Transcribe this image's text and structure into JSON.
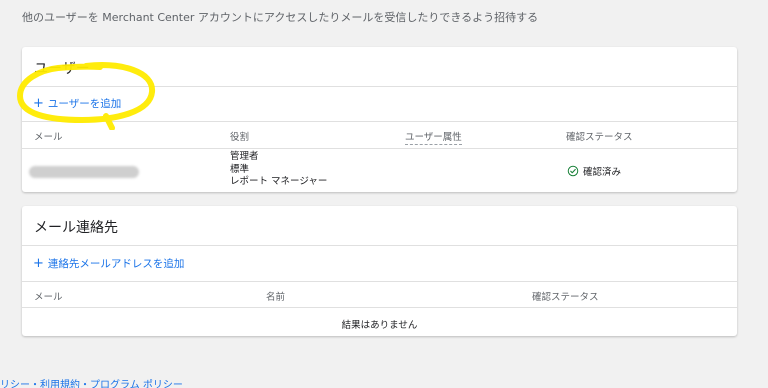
{
  "intro_text": "他のユーザーを Merchant Center アカウントにアクセスしたりメールを受信したりできるよう招待する",
  "users_card": {
    "title": "ユーザー",
    "add_label": "ユーザーを追加",
    "columns": {
      "email": "メール",
      "role": "役割",
      "attribute": "ユーザー属性",
      "status": "確認ステータス"
    },
    "rows": [
      {
        "roles": [
          "管理者",
          "標準",
          "レポート マネージャー"
        ],
        "status": "確認済み"
      }
    ]
  },
  "contacts_card": {
    "title": "メール連絡先",
    "add_label": "連絡先メールアドレスを追加",
    "columns": {
      "email": "メール",
      "name": "名前",
      "status": "確認ステータス"
    },
    "empty_message": "結果はありません"
  },
  "footer_text": "リシー・利用規約・プログラム ポリシー",
  "colors": {
    "accent": "#1a73e8",
    "highlight": "#ffeb00",
    "success": "#188038"
  },
  "icons": {
    "add": "plus-icon",
    "verified": "check-circle-icon"
  }
}
